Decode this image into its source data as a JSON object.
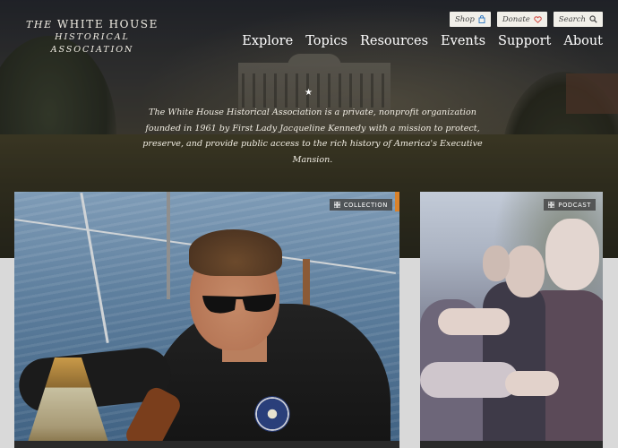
{
  "site": {
    "logo_line1_prefix": "THE",
    "logo_line1_main": "WHITE HOUSE",
    "logo_line2": "HISTORICAL ASSOCIATION"
  },
  "utility_nav": [
    {
      "label": "Shop",
      "icon": "shopping-bag-icon"
    },
    {
      "label": "Donate",
      "icon": "heart-icon"
    },
    {
      "label": "Search",
      "icon": "search-icon"
    }
  ],
  "main_nav": [
    "Explore",
    "Topics",
    "Resources",
    "Events",
    "Support",
    "About"
  ],
  "hero": {
    "mission": "The White House Historical Association is a private, nonprofit organization founded in 1961 by First Lady Jacqueline Kennedy with a mission to protect, preserve, and provide public access to the rich history of America's Executive Mansion."
  },
  "cards": [
    {
      "badge": "COLLECTION",
      "accent_color": "#d9822b"
    },
    {
      "badge": "PODCAST"
    }
  ],
  "colors": {
    "utility_bg": "#f1efe9",
    "badge_bg": "#464646",
    "page_bg": "#d9d9d9"
  }
}
